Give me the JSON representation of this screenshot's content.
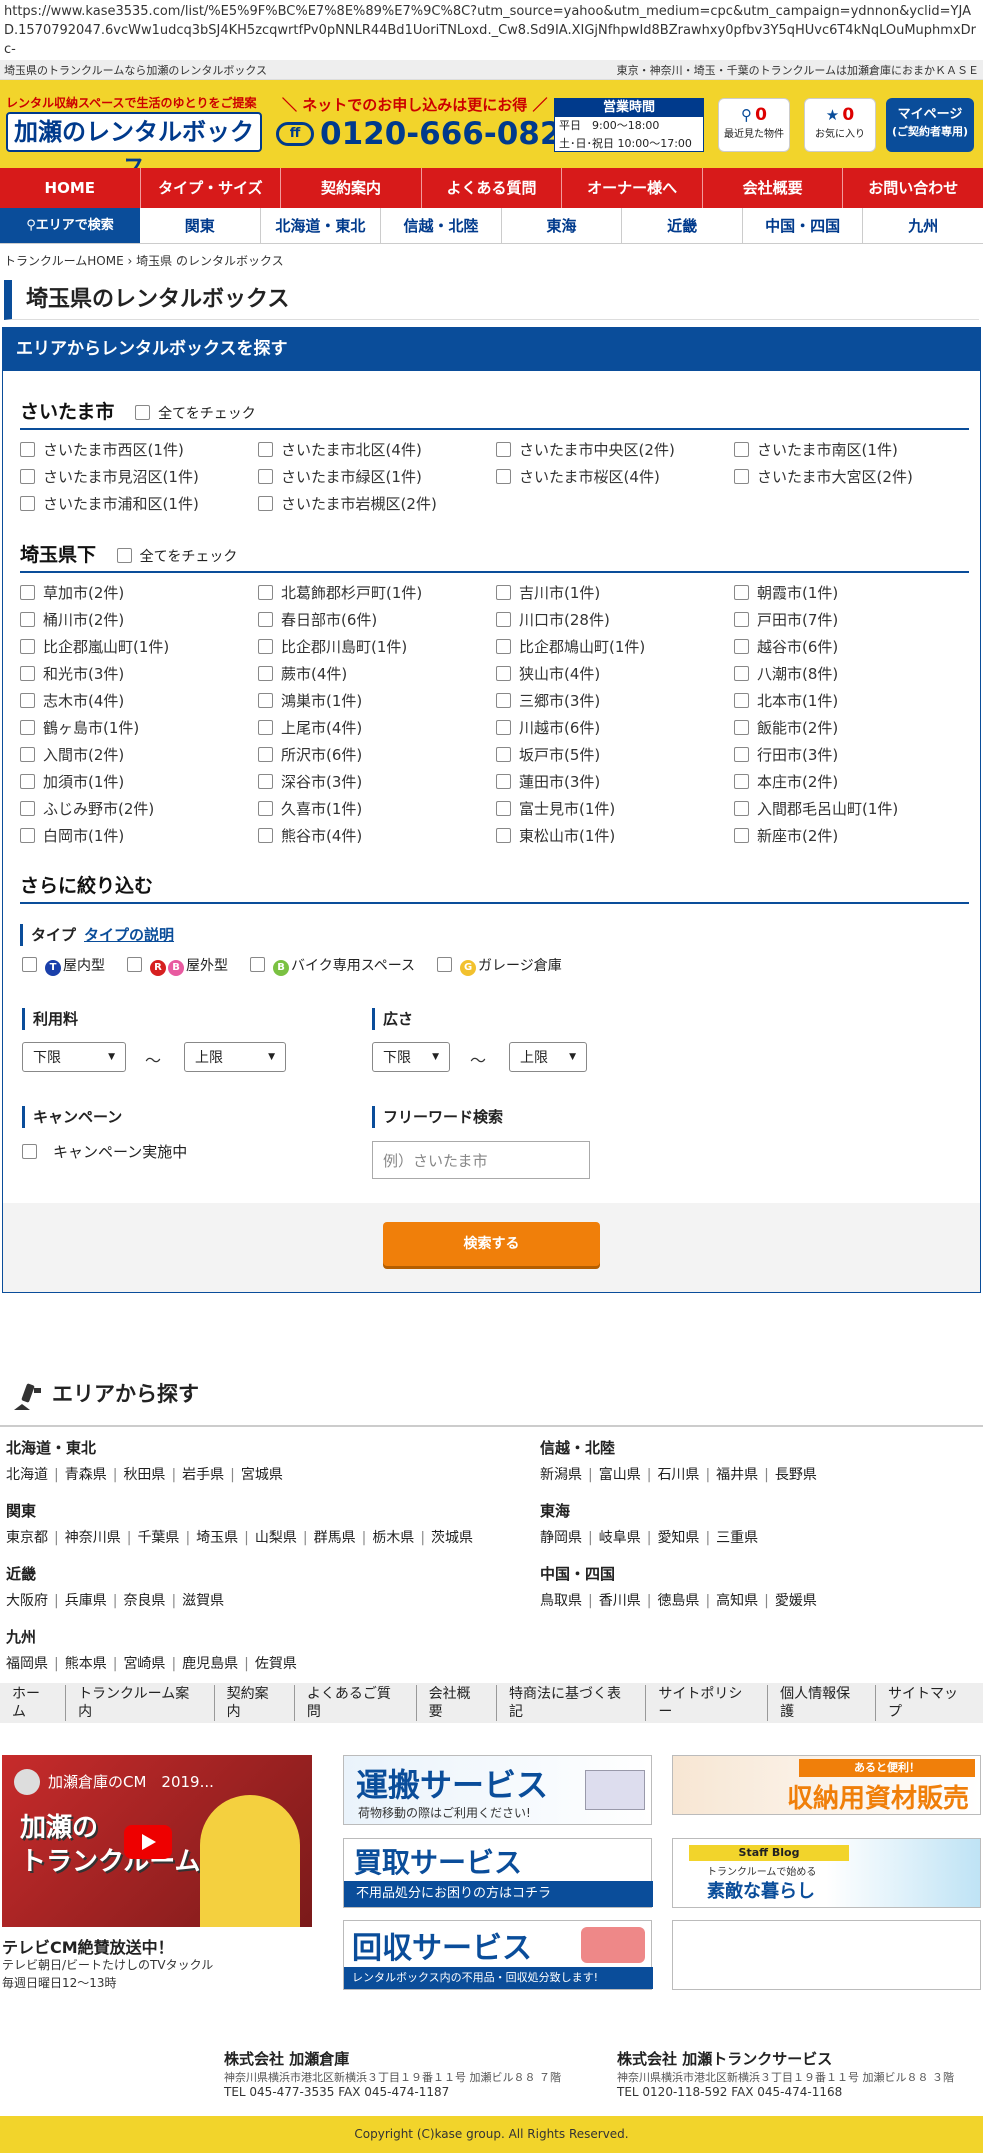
{
  "url": "https://www.kase3535.com/list/%E5%9F%BC%E7%8E%89%E7%9C%8C?utm_source=yahoo&utm_medium=cpc&utm_campaign=ydnnon&yclid=YJAD.1570792047.6vcWw1udcq3bSJ4KH5zcqwrtfPv0pNNLR44Bd1UoriTNLoxd._Cw8.Sd9IA.XIGjNfhpwId8BZrawhxy0pfbv3Y5qHUvc6T4kNqLOuMuphmxDrc-",
  "topline": {
    "left": "埼玉県のトランクルームなら加瀬のレンタルボックス",
    "right": "東京・神奈川・埼玉・千葉のトランクルームは加瀬倉庫におまかＫＡＳＥ"
  },
  "header": {
    "tagline": "レンタル収納スペースで生活のゆとりをご提案",
    "logo": "加瀬のレンタルボックス",
    "net": "＼ ネットでのお申し込みは更にお得 ／",
    "tel": "0120-666-082",
    "tel_icon": "ff",
    "hours_title": "営業時間",
    "hours_weekday_label": "平日",
    "hours_weekday": "9:00～18:00",
    "hours_weekend_label": "土･日･祝日",
    "hours_weekend": "10:00～17:00",
    "recent_count": "0",
    "recent_label": "最近見た物件",
    "fav_count": "0",
    "fav_label": "お気に入り",
    "mypage": "マイページ",
    "mypage_sub": "(ご契約者専用)"
  },
  "nav1": [
    "HOME",
    "タイプ・サイズ",
    "契約案内",
    "よくある質問",
    "オーナー様へ",
    "会社概要",
    "お問い合わせ"
  ],
  "nav2": {
    "search": "エリアで検索",
    "items": [
      "関東",
      "北海道・東北",
      "信越・北陸",
      "東海",
      "近畿",
      "中国・四国",
      "九州"
    ]
  },
  "breadcrumb": {
    "home": "トランクルームHOME",
    "sep": "›",
    "current": "埼玉県 のレンタルボックス"
  },
  "title": "埼玉県のレンタルボックス",
  "search_head": "エリアからレンタルボックスを探す",
  "check_all": "全てをチェック",
  "sec1": {
    "title": "さいたま市",
    "items": [
      "さいたま市西区(1件)",
      "さいたま市北区(4件)",
      "さいたま市中央区(2件)",
      "さいたま市南区(1件)",
      "さいたま市見沼区(1件)",
      "さいたま市緑区(1件)",
      "さいたま市桜区(4件)",
      "さいたま市大宮区(2件)",
      "さいたま市浦和区(1件)",
      "さいたま市岩槻区(2件)"
    ]
  },
  "sec2": {
    "title": "埼玉県下",
    "items": [
      "草加市(2件)",
      "北葛飾郡杉戸町(1件)",
      "吉川市(1件)",
      "朝霞市(1件)",
      "桶川市(2件)",
      "春日部市(6件)",
      "川口市(28件)",
      "戸田市(7件)",
      "比企郡嵐山町(1件)",
      "比企郡川島町(1件)",
      "比企郡鳩山町(1件)",
      "越谷市(6件)",
      "和光市(3件)",
      "蕨市(4件)",
      "狭山市(4件)",
      "八潮市(8件)",
      "志木市(4件)",
      "鴻巣市(1件)",
      "三郷市(3件)",
      "北本市(1件)",
      "鶴ヶ島市(1件)",
      "上尾市(4件)",
      "川越市(6件)",
      "飯能市(2件)",
      "入間市(2件)",
      "所沢市(6件)",
      "坂戸市(5件)",
      "行田市(3件)",
      "加須市(1件)",
      "深谷市(3件)",
      "蓮田市(3件)",
      "本庄市(2件)",
      "ふじみ野市(2件)",
      "久喜市(1件)",
      "富士見市(1件)",
      "入間郡毛呂山町(1件)",
      "白岡市(1件)",
      "熊谷市(4件)",
      "東松山市(1件)",
      "新座市(2件)"
    ]
  },
  "refine": {
    "title": "さらに絞り込む",
    "type_label": "タイプ",
    "type_link": "タイプの説明",
    "types": [
      {
        "badge": "T",
        "color": "#1a3faa",
        "label": "屋内型"
      },
      {
        "badge": "R",
        "badge2": "B",
        "color": "#d62020",
        "color2": "#e85aa0",
        "label": "屋外型"
      },
      {
        "badge": "B",
        "color": "#7ac142",
        "label": "バイク専用スペース"
      },
      {
        "badge": "G",
        "color": "#f2c12e",
        "label": "ガレージ倉庫"
      }
    ],
    "fee_label": "利用料",
    "size_label": "広さ",
    "lower": "下限",
    "upper": "上限",
    "tilde": "～",
    "campaign_label": "キャンペーン",
    "campaign_opt": "キャンペーン実施中",
    "freeword_label": "フリーワード検索",
    "freeword_placeholder": "例）さいたま市",
    "search_button": "検索する"
  },
  "area": {
    "title": "エリアから探す",
    "regions": [
      {
        "name": "北海道・東北",
        "prefs": [
          "北海道",
          "青森県",
          "秋田県",
          "岩手県",
          "宮城県"
        ]
      },
      {
        "name": "関東",
        "prefs": [
          "東京都",
          "神奈川県",
          "千葉県",
          "埼玉県",
          "山梨県",
          "群馬県",
          "栃木県",
          "茨城県"
        ]
      },
      {
        "name": "近畿",
        "prefs": [
          "大阪府",
          "兵庫県",
          "奈良県",
          "滋賀県"
        ]
      },
      {
        "name": "九州",
        "prefs": [
          "福岡県",
          "熊本県",
          "宮崎県",
          "鹿児島県",
          "佐賀県"
        ]
      },
      {
        "name": "信越・北陸",
        "prefs": [
          "新潟県",
          "富山県",
          "石川県",
          "福井県",
          "長野県"
        ]
      },
      {
        "name": "東海",
        "prefs": [
          "静岡県",
          "岐阜県",
          "愛知県",
          "三重県"
        ]
      },
      {
        "name": "中国・四国",
        "prefs": [
          "鳥取県",
          "香川県",
          "徳島県",
          "高知県",
          "愛媛県"
        ]
      }
    ]
  },
  "footnav": [
    "ホーム",
    "トランクルーム案内",
    "契約案内",
    "よくあるご質問",
    "会社概要",
    "特商法に基づく表記",
    "サイトポリシー",
    "個人情報保護",
    "サイトマップ"
  ],
  "promo": {
    "cm_title": "加瀬倉庫のCM　2019...",
    "cm_big": "加瀬の\nトランクルーム",
    "cm_caption": "テレビCM絶賛放送中！",
    "cm_sub1": "テレビ朝日/ビートたけしのTVタックル",
    "cm_sub2": "毎週日曜日12～13時",
    "unpan": "運搬サービス",
    "unpan_sub": "荷物移動の際はご利用ください!",
    "kaitori": "買取サービス",
    "kaitori_sub": "不用品処分にお困りの方はコチラ",
    "kaishu": "回収サービス",
    "kaishu_sub": "レンタルボックス内の不用品・回収処分致します!",
    "shizai_small": "あると便利！",
    "shizai": "収納用資材販売",
    "blog_tag": "Staff Blog",
    "blog_small": "トランクルームで始める",
    "blog": "素敵な暮らし"
  },
  "companies": [
    {
      "name": "株式会社 加瀬倉庫",
      "addr": "神奈川県横浜市港北区新横浜３丁目１９番１１号 加瀬ビル８８ ７階",
      "tel": "TEL 045-477-3535 FAX 045-474-1187"
    },
    {
      "name": "株式会社 加瀬トランクサービス",
      "addr": "神奈川県横浜市港北区新横浜３丁目１９番１１号 加瀬ビル８８ ３階",
      "tel": "TEL 0120-118-592 FAX 045-474-1168"
    }
  ],
  "copyright": "Copyright (C)kase group. All Rights Reserved."
}
